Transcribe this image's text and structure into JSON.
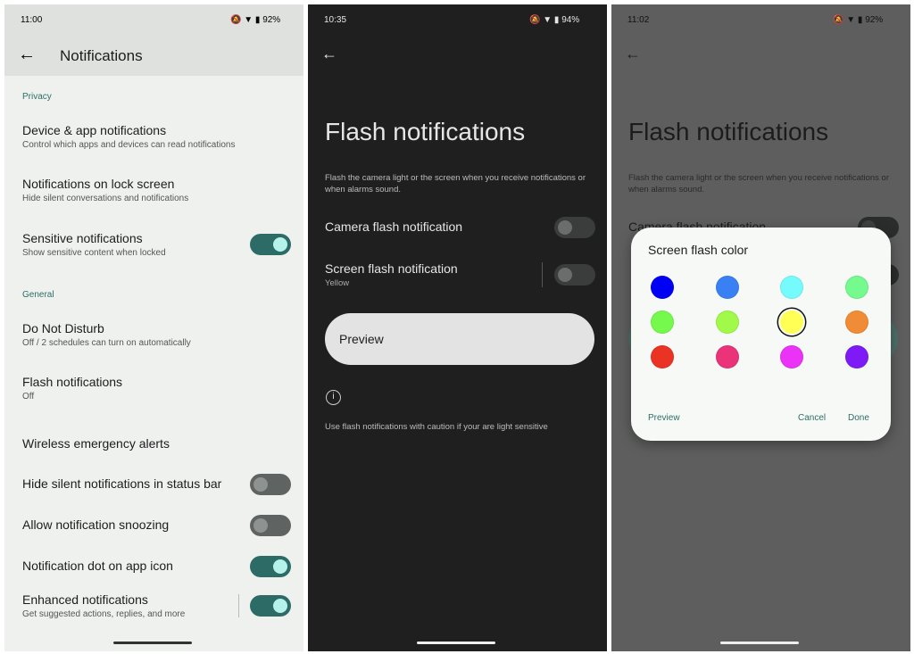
{
  "panel1": {
    "time": "11:00",
    "battery": "92%",
    "title": "Notifications",
    "sections": {
      "privacy": "Privacy",
      "general": "General"
    },
    "items": [
      {
        "title": "Device & app notifications",
        "subtitle": "Control which apps and devices can read notifications"
      },
      {
        "title": "Notifications on lock screen",
        "subtitle": "Hide silent conversations and notifications"
      },
      {
        "title": "Sensitive notifications",
        "subtitle": "Show sensitive content when locked",
        "toggle": true
      },
      {
        "title": "Do Not Disturb",
        "subtitle": "Off / 2 schedules can turn on automatically"
      },
      {
        "title": "Flash notifications",
        "subtitle": "Off"
      },
      {
        "title": "Wireless emergency alerts"
      },
      {
        "title": "Hide silent notifications in status bar",
        "toggle": false
      },
      {
        "title": "Allow notification snoozing",
        "toggle": false
      },
      {
        "title": "Notification dot on app icon",
        "toggle": true
      },
      {
        "title": "Enhanced notifications",
        "subtitle": "Get suggested actions, replies, and more",
        "toggle": true
      }
    ]
  },
  "panel2": {
    "time": "10:35",
    "battery": "94%",
    "title": "Flash notifications",
    "description": "Flash the camera light or the screen when you receive notifications or when alarms sound.",
    "camera": {
      "title": "Camera flash notification",
      "toggle": false
    },
    "screen": {
      "title": "Screen flash notification",
      "subtitle": "Yellow",
      "toggle": false
    },
    "preview": "Preview",
    "caution": "Use flash notifications with caution if your are light sensitive"
  },
  "panel3": {
    "time": "11:02",
    "battery": "92%",
    "title": "Flash notifications",
    "description": "Flash the camera light or the screen when you receive notifications or when alarms sound.",
    "camera_partial": "Camera flash notification",
    "dialog": {
      "title": "Screen flash color",
      "selected": "#ffff55",
      "colors": [
        "#0000f5",
        "#3a80f5",
        "#75fbfd",
        "#75fa8d",
        "#75f94c",
        "#a1f94a",
        "#ffff55",
        "#f08c35",
        "#eb3324",
        "#ea3379",
        "#ea33f7",
        "#7d1af5"
      ],
      "preview": "Preview",
      "cancel": "Cancel",
      "done": "Done"
    }
  },
  "colors": {
    "accent": "#2c6b66"
  }
}
